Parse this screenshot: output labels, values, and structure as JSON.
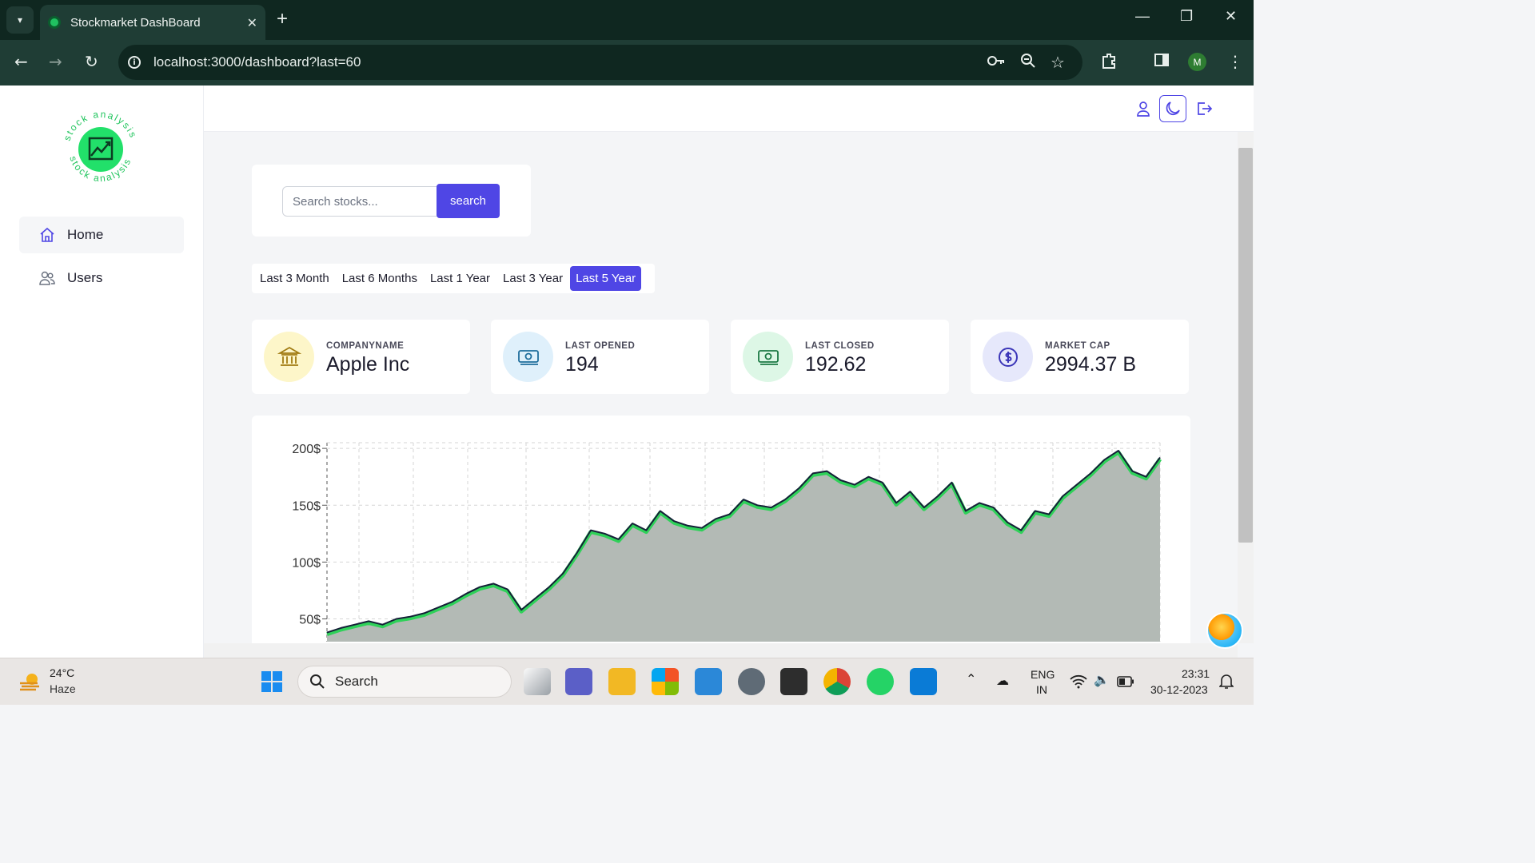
{
  "browser": {
    "tab_title": "Stockmarket DashBoard",
    "url": "localhost:3000/dashboard?last=60",
    "profile_initial": "M"
  },
  "sidebar": {
    "logo_text": "stock analysis",
    "items": [
      {
        "label": "Home",
        "icon": "home-icon",
        "active": true
      },
      {
        "label": "Users",
        "icon": "users-icon",
        "active": false
      }
    ]
  },
  "topbar": {
    "icons": [
      "user-icon",
      "moon-icon",
      "logout-icon"
    ]
  },
  "search": {
    "placeholder": "Search stocks...",
    "button_label": "search"
  },
  "periods": {
    "options": [
      "Last 3 Month",
      "Last 6 Months",
      "Last 1 Year",
      "Last 3 Year",
      "Last 5 Year"
    ],
    "selected": "Last 5 Year"
  },
  "stats": [
    {
      "label": "COMPANYNAME",
      "value": "Apple Inc",
      "icon": "bank-icon",
      "icon_bg": "#fdf6c9",
      "icon_color": "#a07a10"
    },
    {
      "label": "LAST OPENED",
      "value": "194",
      "icon": "money-icon",
      "icon_bg": "#dff0fb",
      "icon_color": "#1f6e9c"
    },
    {
      "label": "LAST CLOSED",
      "value": "192.62",
      "icon": "money-icon",
      "icon_bg": "#ddf7e6",
      "icon_color": "#1c7a45"
    },
    {
      "label": "MARKET CAP",
      "value": "2994.37 B",
      "icon": "dollar-circle-icon",
      "icon_bg": "#e6e8fb",
      "icon_color": "#3b36b8"
    }
  ],
  "chart_data": {
    "type": "area",
    "xlabel": "",
    "ylabel": "",
    "y_ticks": [
      "200$",
      "150$",
      "100$",
      "50$"
    ],
    "ylim": [
      30,
      205
    ],
    "grid": true,
    "x": [
      0,
      1,
      2,
      3,
      4,
      5,
      6,
      7,
      8,
      9,
      10,
      11,
      12,
      13,
      14,
      15,
      16,
      17,
      18,
      19,
      20,
      21,
      22,
      23,
      24,
      25,
      26,
      27,
      28,
      29,
      30,
      31,
      32,
      33,
      34,
      35,
      36,
      37,
      38,
      39,
      40,
      41,
      42,
      43,
      44,
      45,
      46,
      47,
      48,
      49,
      50,
      51,
      52,
      53,
      54,
      55,
      56,
      57,
      58,
      59,
      60
    ],
    "values": [
      38,
      42,
      45,
      48,
      45,
      50,
      52,
      55,
      60,
      65,
      72,
      78,
      81,
      76,
      58,
      68,
      78,
      90,
      108,
      128,
      125,
      120,
      134,
      128,
      145,
      136,
      132,
      130,
      138,
      142,
      155,
      150,
      148,
      155,
      165,
      178,
      180,
      172,
      168,
      175,
      170,
      152,
      162,
      148,
      158,
      170,
      145,
      152,
      148,
      135,
      128,
      145,
      142,
      158,
      168,
      178,
      190,
      198,
      180,
      175,
      192
    ],
    "colors": {
      "fill": "#b3bab5",
      "line": "#151f38",
      "glow": "#2fd159"
    }
  },
  "taskbar": {
    "temperature": "24°C",
    "weather": "Haze",
    "search_label": "Search",
    "language": "ENG",
    "region": "IN",
    "time": "23:31",
    "date": "30-12-2023"
  }
}
